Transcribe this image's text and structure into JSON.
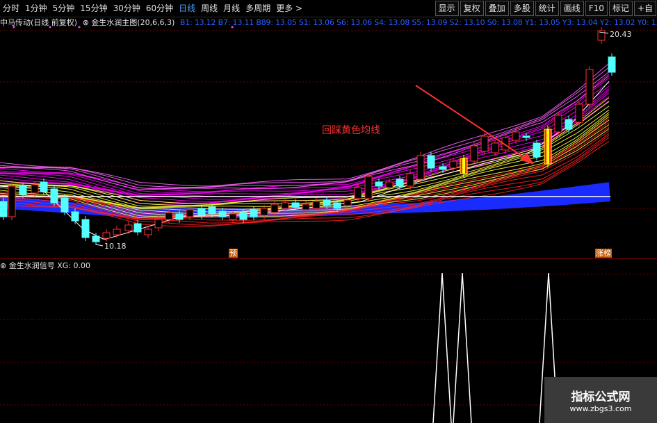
{
  "toolbar": {
    "periods": [
      "分时",
      "1分钟",
      "5分钟",
      "15分钟",
      "30分钟",
      "60分钟",
      "日线",
      "周线",
      "月线",
      "多周期",
      "更多 >"
    ],
    "active_period": "日线",
    "right_buttons": [
      "显示",
      "复权",
      "叠加",
      "多股",
      "统计",
      "画线",
      "F10",
      "标记",
      "+自"
    ]
  },
  "info": {
    "stock": "中马传动(日线 前复权)",
    "indicator": "⊗ 金生水润主图(20,6,6,3)",
    "signals": "B1: 13.12  B7: 13.11  B89: 13.05  S1: 13.06  S6: 13.06  S4: 13.08  S5: 13.09  S2: 13.10  S0: 13.08  Y1: 13.05  Y3: 13.04  Y2: 13.02  Y0: 13.05"
  },
  "annotation": "回踩黄色均线",
  "low_label": "10.18",
  "high_label": "20.43",
  "tags": {
    "pre": "预",
    "limit_up": "涨榜"
  },
  "sub_panel": {
    "title": "⊗ 金生水润信号 XG: 0.00"
  },
  "watermark": {
    "line1": "指标公式网",
    "line2": "www.zbgs3.com"
  },
  "colors": {
    "up": "#ff3030",
    "down": "#54ffff",
    "signal": "#ffffff",
    "grid": "#7a0000"
  }
}
